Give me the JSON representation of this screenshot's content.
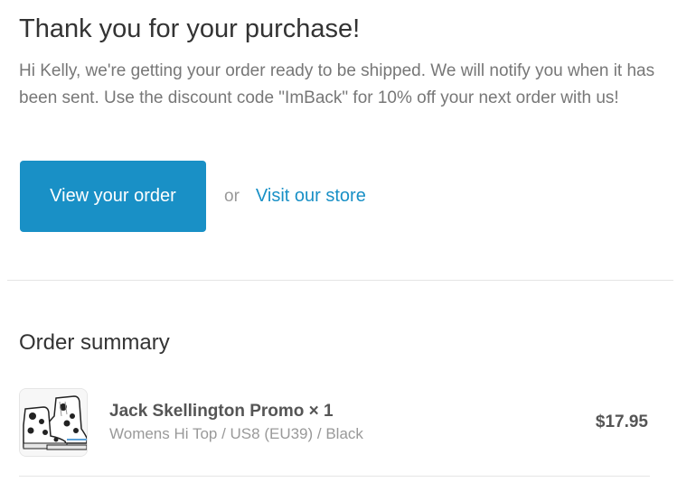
{
  "header": {
    "title": "Thank you for your purchase!",
    "message": "Hi Kelly, we're getting your order ready to be shipped. We will notify you when it has been sent. Use the discount code \"ImBack\" for 10% off your next order with us!"
  },
  "actions": {
    "view_order_label": "View your order",
    "or_label": "or",
    "visit_store_label": "Visit our store"
  },
  "summary": {
    "title": "Order summary",
    "items": [
      {
        "name": "Jack Skellington Promo × 1",
        "variant": "Womens Hi Top / US8 (EU39) / Black",
        "price": "$17.95",
        "image_icon": "sneaker-product-image"
      }
    ]
  },
  "colors": {
    "accent": "#1990c6",
    "text": "#333333",
    "muted": "#777777",
    "divider": "#e5e5e5"
  }
}
